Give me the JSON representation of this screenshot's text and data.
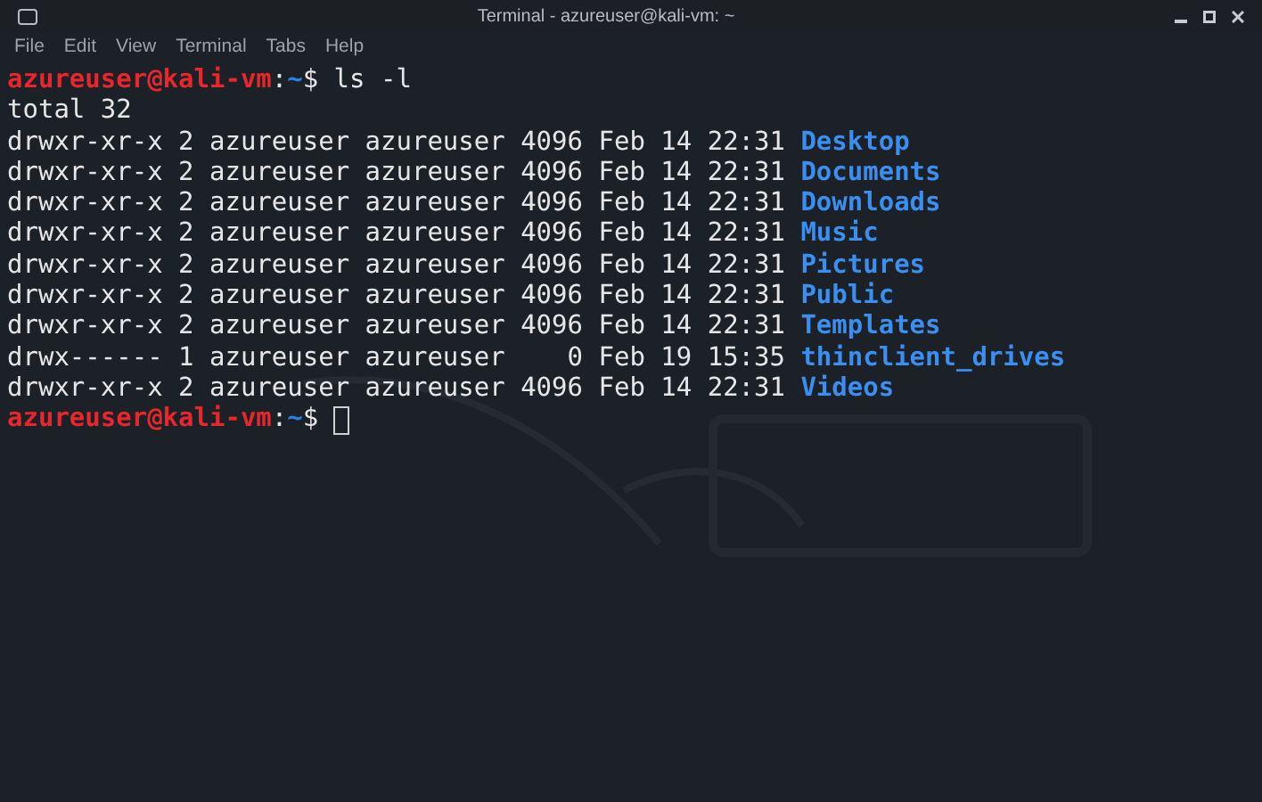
{
  "window": {
    "title": "Terminal - azureuser@kali-vm: ~"
  },
  "menu": [
    "File",
    "Edit",
    "View",
    "Terminal",
    "Tabs",
    "Help"
  ],
  "lines": [
    {
      "kind": "prompt",
      "user_host": "azureuser@kali-vm",
      "separator": ":",
      "path": "~",
      "symbol": "$",
      "command": "ls -l",
      "cursor": false
    },
    {
      "kind": "text",
      "text": "total 32"
    },
    {
      "kind": "entry",
      "details": "drwxr-xr-x 2 azureuser azureuser 4096 Feb 14 22:31",
      "name": "Desktop"
    },
    {
      "kind": "entry",
      "details": "drwxr-xr-x 2 azureuser azureuser 4096 Feb 14 22:31",
      "name": "Documents"
    },
    {
      "kind": "entry",
      "details": "drwxr-xr-x 2 azureuser azureuser 4096 Feb 14 22:31",
      "name": "Downloads"
    },
    {
      "kind": "entry",
      "details": "drwxr-xr-x 2 azureuser azureuser 4096 Feb 14 22:31",
      "name": "Music"
    },
    {
      "kind": "entry",
      "details": "drwxr-xr-x 2 azureuser azureuser 4096 Feb 14 22:31",
      "name": "Pictures"
    },
    {
      "kind": "entry",
      "details": "drwxr-xr-x 2 azureuser azureuser 4096 Feb 14 22:31",
      "name": "Public"
    },
    {
      "kind": "entry",
      "details": "drwxr-xr-x 2 azureuser azureuser 4096 Feb 14 22:31",
      "name": "Templates"
    },
    {
      "kind": "entry",
      "details": "drwx------ 1 azureuser azureuser    0 Feb 19 15:35",
      "name": "thinclient_drives"
    },
    {
      "kind": "entry",
      "details": "drwxr-xr-x 2 azureuser azureuser 4096 Feb 14 22:31",
      "name": "Videos"
    },
    {
      "kind": "prompt",
      "user_host": "azureuser@kali-vm",
      "separator": ":",
      "path": "~",
      "symbol": "$",
      "cursor": true
    }
  ]
}
